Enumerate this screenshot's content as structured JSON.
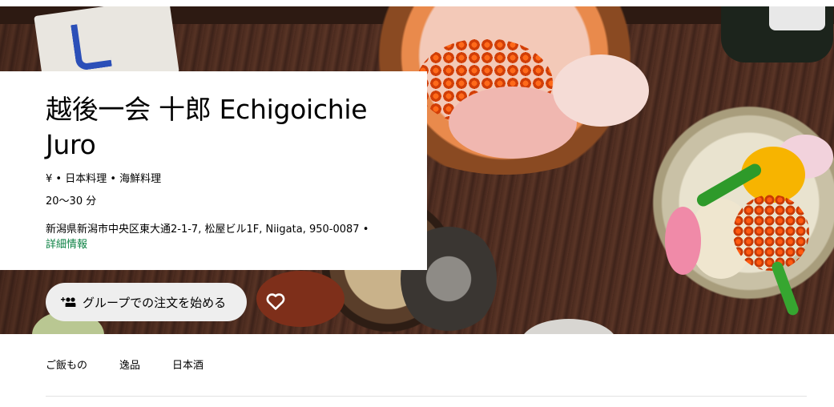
{
  "store": {
    "name": "越後一会 十郎 Echigoichie Juro",
    "cuisine_line": "¥ • 日本料理 • 海鮮料理",
    "delivery_time": "20〜30 分",
    "address": "新潟県新潟市中央区東大通2-1-7, 松屋ビル1F, Niigata, 950-0087 • ",
    "details_link": "詳細情報"
  },
  "actions": {
    "group_order_label": "グループでの注文を始める",
    "group_order_icon": "add-group-icon",
    "favorite_icon": "heart-outline-icon"
  },
  "category_tabs": [
    {
      "label": "ご飯もの"
    },
    {
      "label": "逸品"
    },
    {
      "label": "日本酒"
    }
  ],
  "colors": {
    "link_green": "#0e8345",
    "button_bg": "#eeeeee",
    "divider": "#e2e2e2"
  }
}
